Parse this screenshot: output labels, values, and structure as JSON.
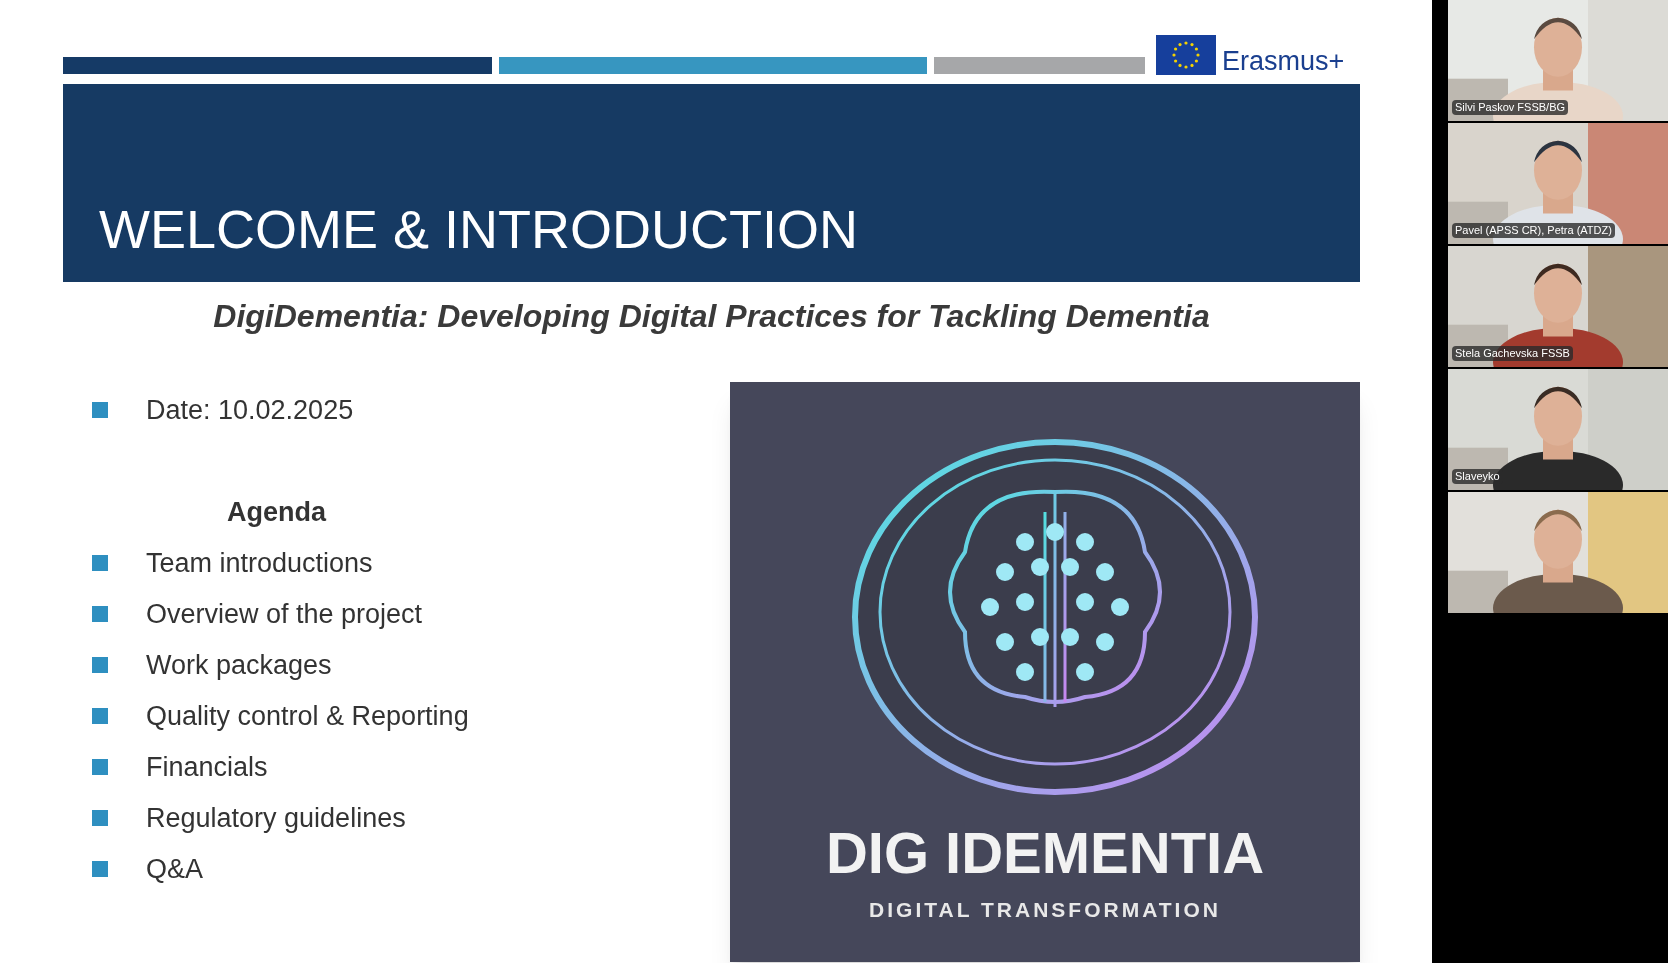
{
  "slide": {
    "logo": {
      "text": "Erasmus+"
    },
    "title": "WELCOME & INTRODUCTION",
    "subtitle": "DigiDementia: Developing Digital Practices for Tackling Dementia",
    "date_item": "Date: 10.02.2025",
    "agenda": {
      "heading": "Agenda",
      "items": [
        "Team introductions",
        "Overview of the project",
        "Work packages",
        "Quality control & Reporting",
        "Financials",
        "Regulatory guidelines",
        "Q&A"
      ]
    },
    "image": {
      "title": "DIG IDEMENTIA",
      "tagline": "DIGITAL TRANSFORMATION"
    }
  },
  "participants": [
    {
      "kind": "named",
      "name": "Silvi Paskov FSSB/BG"
    },
    {
      "kind": "named",
      "name": "Pavel (APSS CR), Petra (ATDZ)"
    },
    {
      "kind": "named",
      "name": "Stela Gachevska FSSB"
    },
    {
      "kind": "named",
      "name": "Slaveyko"
    },
    {
      "kind": "picture"
    }
  ]
}
